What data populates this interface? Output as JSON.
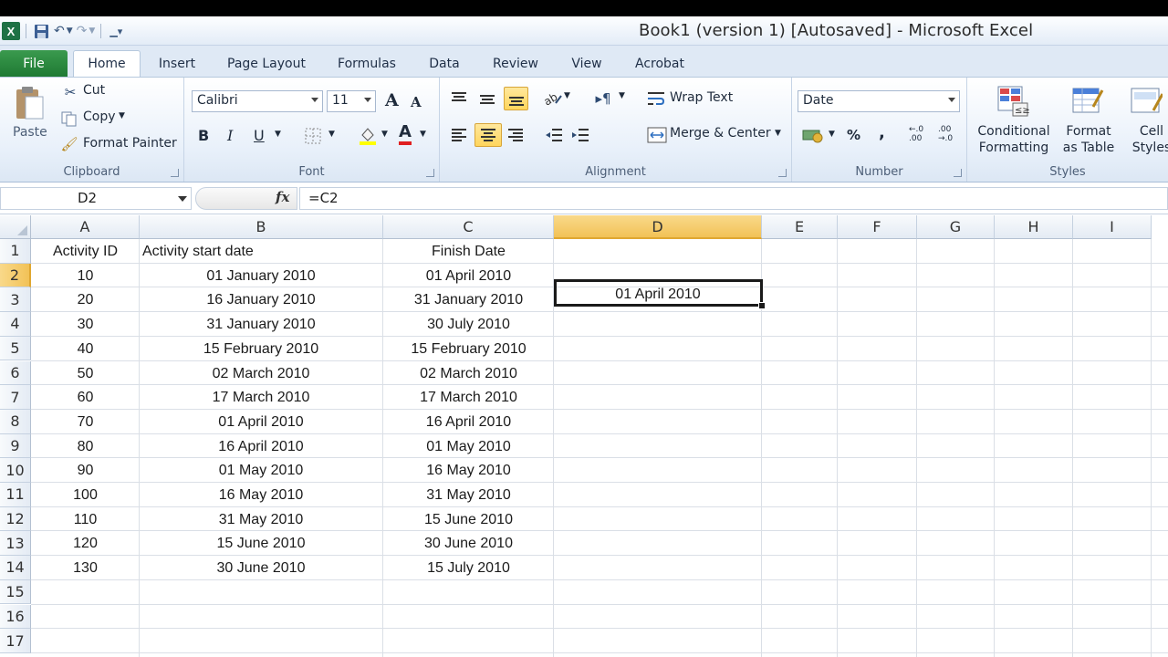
{
  "window": {
    "title": "Book1 (version 1) [Autosaved]  -  Microsoft Excel"
  },
  "qat": {
    "icons": [
      "excel-logo-icon",
      "save-icon",
      "undo-icon",
      "redo-icon",
      "customize-qat-icon"
    ],
    "logo_letter": "X"
  },
  "tabs": [
    {
      "label": "File"
    },
    {
      "label": "Home"
    },
    {
      "label": "Insert"
    },
    {
      "label": "Page Layout"
    },
    {
      "label": "Formulas"
    },
    {
      "label": "Data"
    },
    {
      "label": "Review"
    },
    {
      "label": "View"
    },
    {
      "label": "Acrobat"
    }
  ],
  "ribbon": {
    "clipboard": {
      "label": "Clipboard",
      "paste": "Paste",
      "cut": "Cut",
      "copy": "Copy",
      "format_painter": "Format Painter"
    },
    "font": {
      "label": "Font",
      "font_name": "Calibri",
      "font_size": "11",
      "bold": "B",
      "italic": "I",
      "underline": "U",
      "grow": "A",
      "shrink": "A",
      "color": "A"
    },
    "alignment": {
      "label": "Alignment",
      "wrap_text": "Wrap Text",
      "merge_center": "Merge & Center"
    },
    "number": {
      "label": "Number",
      "format": "Date",
      "percent": "%",
      "comma": ",",
      "inc_decimal": "←.0 .00",
      "dec_decimal": ".00 →.0"
    },
    "styles": {
      "label": "Styles",
      "conditional_1": "Conditional",
      "conditional_2": "Formatting",
      "format_table_1": "Format",
      "format_table_2": "as Table",
      "cell_styles_1": "Cell",
      "cell_styles_2": "Styles"
    }
  },
  "formula_bar": {
    "name_box": "D2",
    "fx": "fx",
    "formula": "=C2"
  },
  "sheet": {
    "columns": [
      "A",
      "B",
      "C",
      "D",
      "E",
      "F",
      "G",
      "H",
      "I"
    ],
    "selected_column": "D",
    "row_numbers": [
      "1",
      "2",
      "3",
      "4",
      "5",
      "6",
      "7",
      "8",
      "9",
      "10",
      "11",
      "12",
      "13",
      "14",
      "15",
      "16",
      "17"
    ],
    "selected_row": "2",
    "headers": {
      "a": "Activity ID",
      "b": "Activity start date",
      "c": "Finish Date"
    },
    "rows": [
      {
        "a": "10",
        "b": "01 January 2010",
        "c": "01 April 2010"
      },
      {
        "a": "20",
        "b": "16 January 2010",
        "c": "31 January 2010"
      },
      {
        "a": "30",
        "b": "31 January 2010",
        "c": "30 July 2010"
      },
      {
        "a": "40",
        "b": "15 February 2010",
        "c": "15 February 2010"
      },
      {
        "a": "50",
        "b": "02 March 2010",
        "c": "02 March 2010"
      },
      {
        "a": "60",
        "b": "17 March 2010",
        "c": "17 March 2010"
      },
      {
        "a": "70",
        "b": "01 April 2010",
        "c": "16 April 2010"
      },
      {
        "a": "80",
        "b": "16 April 2010",
        "c": "01 May 2010"
      },
      {
        "a": "90",
        "b": "01 May 2010",
        "c": "16 May 2010"
      },
      {
        "a": "100",
        "b": "16 May 2010",
        "c": "31 May 2010"
      },
      {
        "a": "110",
        "b": "31 May 2010",
        "c": "15 June 2010"
      },
      {
        "a": "120",
        "b": "15 June 2010",
        "c": "30 June 2010"
      },
      {
        "a": "130",
        "b": "30 June 2010",
        "c": "15 July 2010"
      }
    ],
    "active_cell_value": "01 April 2010"
  },
  "colors": {
    "file_tab": "#1f7a33",
    "selection_header": "#f2c257",
    "highlight_button": "#ffd55c"
  }
}
